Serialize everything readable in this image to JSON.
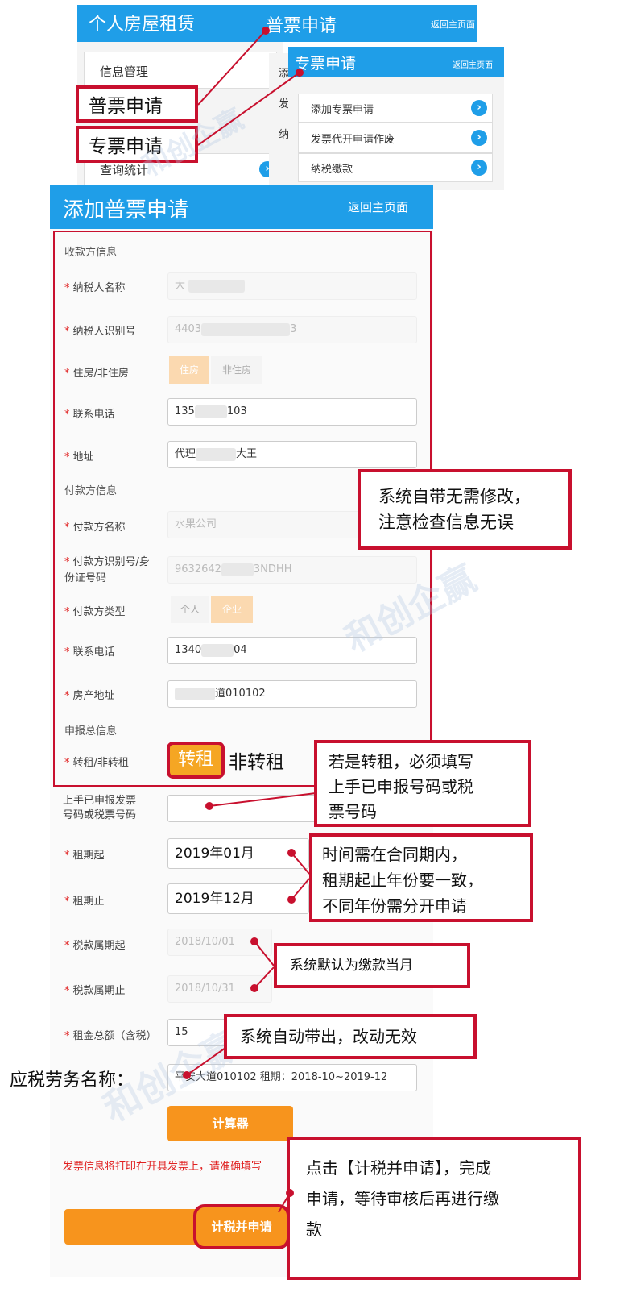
{
  "top_left_panel": {
    "title": "个人房屋租赁",
    "tab_title": "普票申请",
    "back_label": "返回主页面",
    "items": [
      "信息管理",
      "查询统计"
    ],
    "col2_stubs": [
      "添",
      "发",
      "纳"
    ]
  },
  "top_right_panel": {
    "title": "专票申请",
    "back_label": "返回主页面",
    "items": [
      "添加专票申请",
      "发票代开申请作废",
      "纳税缴款"
    ]
  },
  "callouts": {
    "putong": "普票申请",
    "zhuanpiao": "专票申请",
    "system_default": [
      "系统自带无需修改，",
      "注意检查信息无误"
    ],
    "sublease": [
      "若是转租，必须填写",
      "上手已申报号码或税",
      "票号码"
    ],
    "period": [
      "时间需在合同期内，",
      "租期起止年份要一致，",
      "不同年份需分开申请"
    ],
    "tax_month": "系统默认为缴款当月",
    "auto": "系统自动带出，改动无效",
    "submit": [
      "点击【计税并申请】，完成",
      "申请，等待审核后再进行缴",
      "款"
    ],
    "service_name_label": "应税劳务名称："
  },
  "form": {
    "title": "添加普票申请",
    "back_label": "返回主页面",
    "section_payee": "收款方信息",
    "section_payer": "付款方信息",
    "section_summary": "申报总信息",
    "fields": {
      "taxpayer_name": {
        "label": "纳税人名称",
        "value": "大"
      },
      "taxpayer_id": {
        "label": "纳税人识别号",
        "value": "4403",
        "value_end": "3"
      },
      "housing_type": {
        "label": "住房/非住房",
        "options": [
          "住房",
          "非住房"
        ]
      },
      "phone": {
        "label": "联系电话",
        "value": "135",
        "value_end": "103"
      },
      "address": {
        "label": "地址",
        "value": "代理",
        "value_end": "大王"
      },
      "payer_name": {
        "label": "付款方名称",
        "value": "水果公司"
      },
      "payer_id": {
        "label": "付款方识别号/身份证号码",
        "label_lines": [
          "付款方识别号/身",
          "份证号码"
        ],
        "value": "9632642",
        "value_end": "3NDHH"
      },
      "payer_type": {
        "label": "付款方类型",
        "options": [
          "个人",
          "企业"
        ]
      },
      "payer_phone": {
        "label": "联系电话",
        "value": "1340",
        "value_end": "04"
      },
      "property_address": {
        "label": "房产地址",
        "value": "道010102"
      },
      "sublease": {
        "label": "转租/非转租",
        "options": [
          "转租",
          "非转租"
        ]
      },
      "prev_invoice": {
        "label_lines": [
          "上手已申报发票",
          "号码或税票号码"
        ],
        "value": ""
      },
      "rent_start": {
        "label": "租期起",
        "value": "2019年01月"
      },
      "rent_end": {
        "label": "租期止",
        "value": "2019年12月"
      },
      "tax_start": {
        "label": "税款属期起",
        "value": "2018/10/01"
      },
      "tax_end": {
        "label": "税款属期止",
        "value": "2018/10/31"
      },
      "rent_total": {
        "label": "租金总额（含税）",
        "value": "15"
      },
      "service_name": {
        "value": "平安大道010102 租期：2018-10~2019-12"
      }
    },
    "calc_button": "计算器",
    "notice": "发票信息将打印在开具发票上，请准确填写",
    "submit_button": "计税并申请"
  },
  "watermark": {
    "brand": "和创企赢"
  },
  "colors": {
    "accent_blue": "#1f9ee8",
    "callout_red": "#c8102e",
    "orange": "#f7941d",
    "highlight_orange": "#f5a623"
  }
}
